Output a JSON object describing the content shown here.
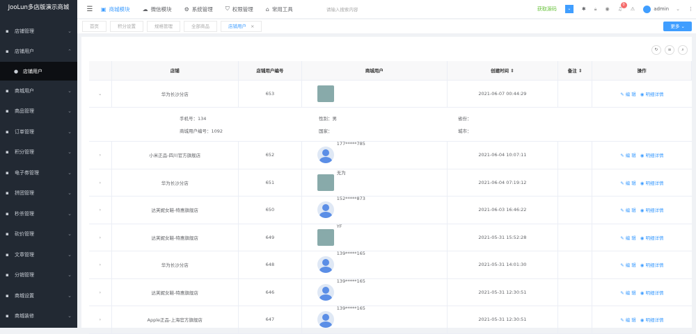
{
  "app_title": "JooLun多店版演示商城",
  "sidebar": [
    {
      "label": "店铺管理",
      "icon": "shop-icon",
      "chev": "⌄"
    },
    {
      "label": "店铺用户",
      "icon": "user-icon",
      "chev": "⌃"
    },
    {
      "label": "店铺用户",
      "icon": "user-solid-icon",
      "child": true
    },
    {
      "label": "商城用户",
      "icon": "user-card-icon",
      "chev": "⌄"
    },
    {
      "label": "商品管理",
      "icon": "goods-icon",
      "chev": "⌄"
    },
    {
      "label": "订单管理",
      "icon": "order-icon",
      "chev": "⌄"
    },
    {
      "label": "积分管理",
      "icon": "points-icon",
      "chev": "⌄"
    },
    {
      "label": "电子劵管理",
      "icon": "coupon-icon",
      "chev": "⌄"
    },
    {
      "label": "拼团管理",
      "icon": "group-icon",
      "chev": "⌄"
    },
    {
      "label": "秒杀管理",
      "icon": "flash-icon",
      "chev": "⌄"
    },
    {
      "label": "砍价管理",
      "icon": "bargain-icon",
      "chev": "⌄"
    },
    {
      "label": "文章管理",
      "icon": "article-icon",
      "chev": "⌄"
    },
    {
      "label": "分销管理",
      "icon": "share-icon",
      "chev": "⌄"
    },
    {
      "label": "商城设置",
      "icon": "settings-icon",
      "chev": "⌄"
    },
    {
      "label": "商城装修",
      "icon": "decorate-icon",
      "chev": "⌄"
    }
  ],
  "header": {
    "nav": [
      {
        "label": "商城模块",
        "icon": "▣",
        "active": true
      },
      {
        "label": "微信模块",
        "icon": "☁"
      },
      {
        "label": "系统管理",
        "icon": "⚙"
      },
      {
        "label": "权限管理",
        "icon": "⛉"
      },
      {
        "label": "常用工具",
        "icon": "⌂"
      }
    ],
    "search_placeholder": "请输入搜索内容",
    "get_source": "获取源码",
    "badge": "0",
    "user": "admin"
  },
  "tabs": [
    {
      "label": "首页"
    },
    {
      "label": "积分设置"
    },
    {
      "label": "规格管理"
    },
    {
      "label": "全部商品"
    },
    {
      "label": "店铺用户",
      "active": true,
      "close": "×"
    }
  ],
  "more_label": "更多",
  "table": {
    "headers": [
      "店铺",
      "店铺用户编号",
      "商城用户",
      "创建时间 ⇕",
      "备注 ⇕",
      "操作"
    ],
    "edit_label": "✎ 编 辑",
    "detail_label": "◉ 明细详情",
    "rows": [
      {
        "shop": "华为长沙分店",
        "id": "653",
        "user": "",
        "avatar": "img",
        "time": "2021-06-07 00:44:29",
        "expanded": true
      },
      {
        "shop": "小米正品-四川官方旗舰店",
        "id": "652",
        "user": "177*****785",
        "avatar": "default",
        "time": "2021-06-04 10:07:11"
      },
      {
        "shop": "华为长沙分店",
        "id": "651",
        "user": "无为",
        "avatar": "img",
        "time": "2021-06-04 07:19:12"
      },
      {
        "shop": "达芙妮女鞋-特惠旗舰店",
        "id": "650",
        "user": "152*****873",
        "avatar": "default",
        "time": "2021-06-03 16:46:22"
      },
      {
        "shop": "达芙妮女鞋-特惠旗舰店",
        "id": "649",
        "user": "YF",
        "avatar": "img",
        "time": "2021-05-31 15:52:28"
      },
      {
        "shop": "华为长沙分店",
        "id": "648",
        "user": "139*****165",
        "avatar": "default",
        "time": "2021-05-31 14:01:30"
      },
      {
        "shop": "达芙妮女鞋-特惠旗舰店",
        "id": "646",
        "user": "139*****165",
        "avatar": "default",
        "time": "2021-05-31 12:30:51"
      },
      {
        "shop": "Apple正品-上海官方旗舰店",
        "id": "647",
        "user": "139*****165",
        "avatar": "default",
        "time": "2021-05-31 12:30:51"
      }
    ],
    "detail": {
      "phone": "手机号：134",
      "gender": "性别：男",
      "province": "省份：",
      "mall_id": "商城用户编号：1092",
      "country": "国家：",
      "city": "城市："
    }
  }
}
